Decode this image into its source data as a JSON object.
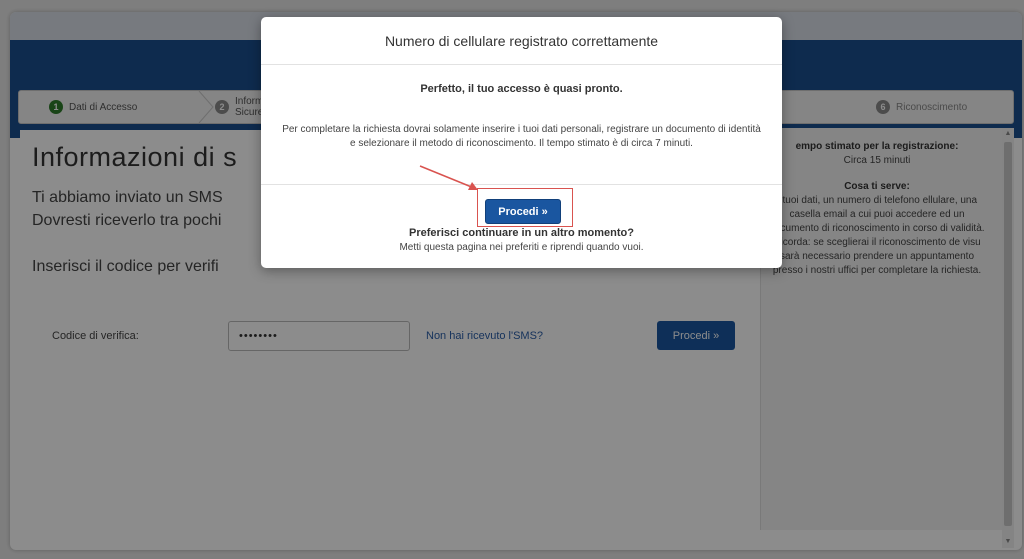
{
  "steps": [
    {
      "num": "1",
      "label": "Dati di Accesso"
    },
    {
      "num": "2",
      "label_line1": "Inform",
      "label_line2": "Sicure"
    },
    {
      "num": "6",
      "label": "Riconoscimento"
    }
  ],
  "main": {
    "title": "Informazioni di s",
    "line1": "Ti abbiamo inviato un SMS",
    "line2": "Dovresti riceverlo tra pochi",
    "line3": "Inserisci il codice per verifi",
    "code_label": "Codice di verifica:",
    "code_value": "••••••••",
    "resend_link": "Non hai ricevuto l'SMS?",
    "submit_label": "Procedi »"
  },
  "sidebar": {
    "estimate_title": "empo stimato per la registrazione:",
    "estimate_value": "Circa 15 minuti",
    "needs_title": "Cosa ti serve:",
    "needs_text": "I tuoi dati, un numero di telefono ellulare, una casella email a cui puoi accedere ed un documento di riconoscimento in corso di validità. Ricorda: se sceglierai il riconoscimento de visu sarà necessario prendere un appuntamento presso i nostri uffici per completare la richiesta."
  },
  "modal": {
    "title": "Numero di cellulare registrato correttamente",
    "lead": "Perfetto, il tuo accesso è quasi pronto.",
    "body": "Per completare la richiesta dovrai solamente inserire i tuoi dati personali, registrare un documento di identità e selezionare il metodo di riconoscimento. Il tempo stimato è di circa 7 minuti.",
    "proceed_label": "Procedi »",
    "later_title": "Preferisci continuare in un altro momento?",
    "later_text": "Metti questa pagina nei preferiti e riprendi quando vuoi."
  },
  "colors": {
    "brand_blue": "#1b4f8f",
    "button_blue": "#1a56a0",
    "step_done": "#2f7d2a",
    "highlight_red": "#d9534f"
  },
  "icons": {
    "scroll_up": "▲",
    "scroll_down": "▼"
  }
}
